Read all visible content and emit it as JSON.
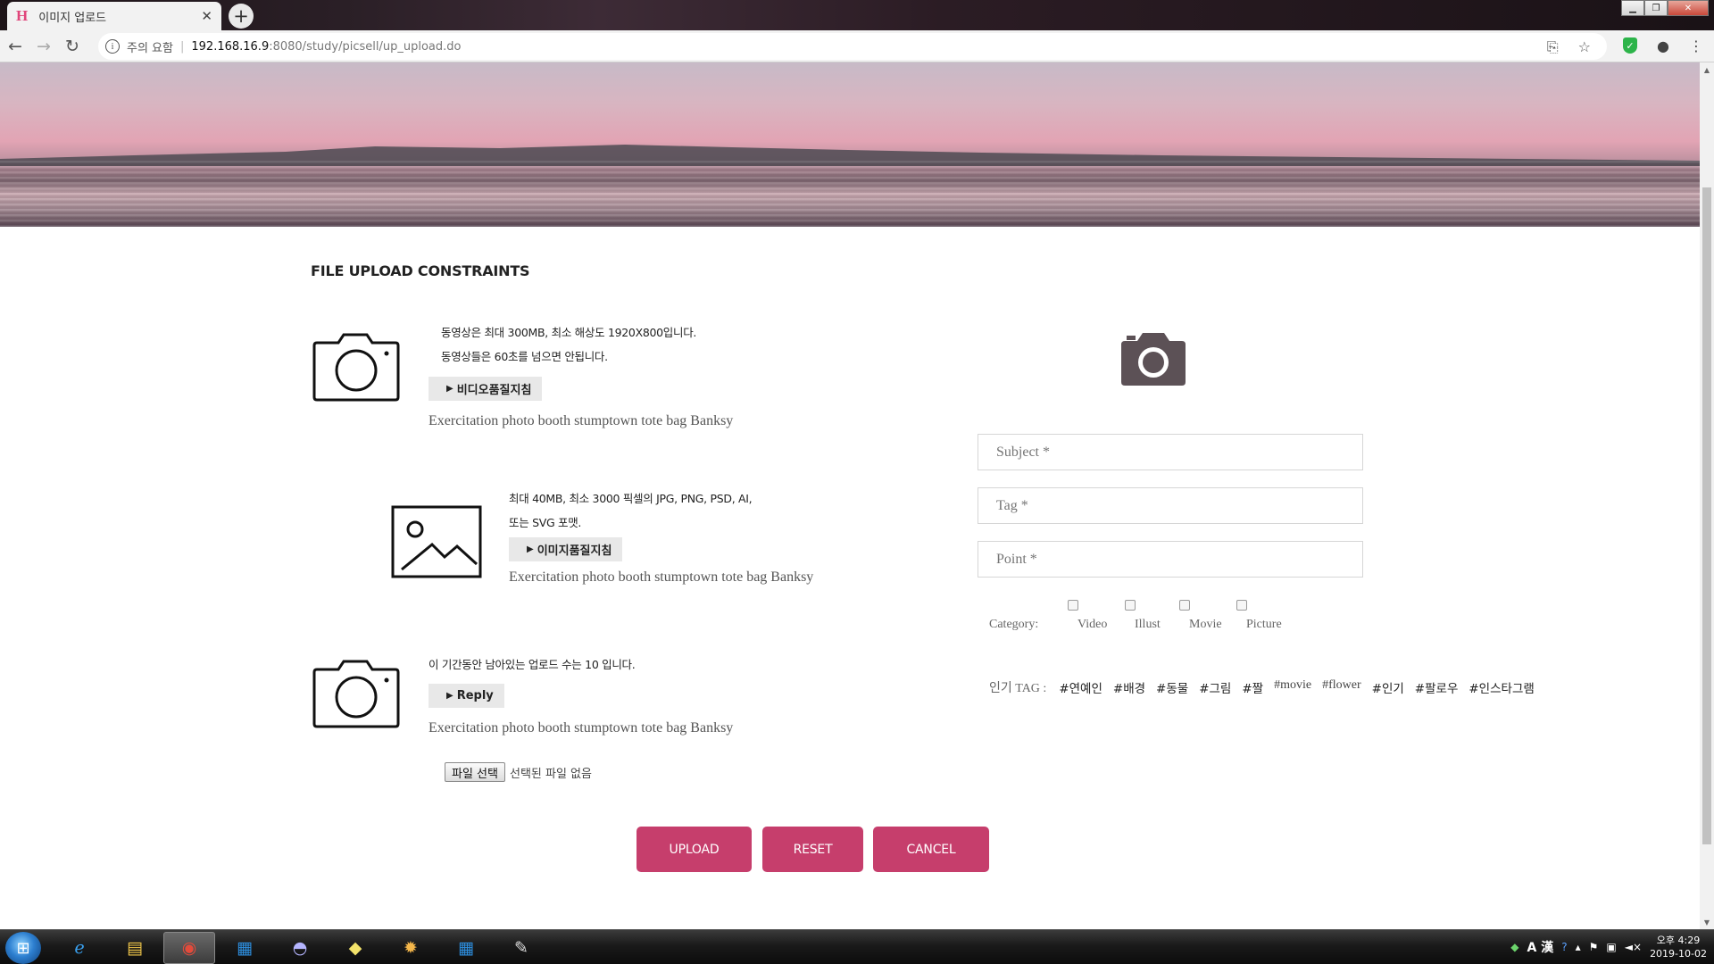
{
  "browser": {
    "tab_title": "이미지 업로드",
    "tab_favicon": "H",
    "new_tab": "+",
    "security_label": "주의 요함",
    "url_host": "192.168.16.9",
    "url_path": ":8080/study/picsell/up_upload.do"
  },
  "page": {
    "section_title": "FILE UPLOAD CONSTRAINTS",
    "video_block": {
      "line1": "동영상은 최대 300MB, 최소 해상도 1920X800입니다.",
      "line2": "동영상들은 60초를 넘으면 안됩니다.",
      "button": "비디오품질지침",
      "desc": "Exercitation photo booth stumptown tote bag Banksy"
    },
    "image_block": {
      "line1": "최대 40MB, 최소 3000 픽셀의 JPG, PNG, PSD, AI,",
      "line2": "또는 SVG 포맷.",
      "button": "이미지품질지침",
      "desc": "Exercitation photo booth stumptown tote bag Banksy"
    },
    "reply_block": {
      "line1": "이 기간동안 남아있는 업로드 수는 10 입니다.",
      "button": "Reply",
      "desc": "Exercitation photo booth stumptown tote bag Banksy"
    },
    "file_input": {
      "button": "파일 선택",
      "status": "선택된 파일 없음"
    },
    "actions": {
      "upload": "UPLOAD",
      "reset": "RESET",
      "cancel": "CANCEL"
    },
    "form": {
      "subject_placeholder": "Subject *",
      "tag_placeholder": "Tag *",
      "point_placeholder": "Point *",
      "category_label": "Category:",
      "categories": [
        "Video",
        "Illust",
        "Movie",
        "Picture"
      ],
      "popular_tag_label": "인기 TAG :",
      "popular_tags": [
        "#연예인",
        "#배경",
        "#동물",
        "#그림",
        "#짤",
        "#movie",
        "#flower",
        "#인기",
        "#팔로우",
        "#인스타그램"
      ]
    }
  },
  "taskbar": {
    "clock_time": "오후 4:29",
    "clock_date": "2019-10-02",
    "ime": "A 漢"
  },
  "colors": {
    "accent": "#c63e6c",
    "favicon": "#e0457a"
  }
}
